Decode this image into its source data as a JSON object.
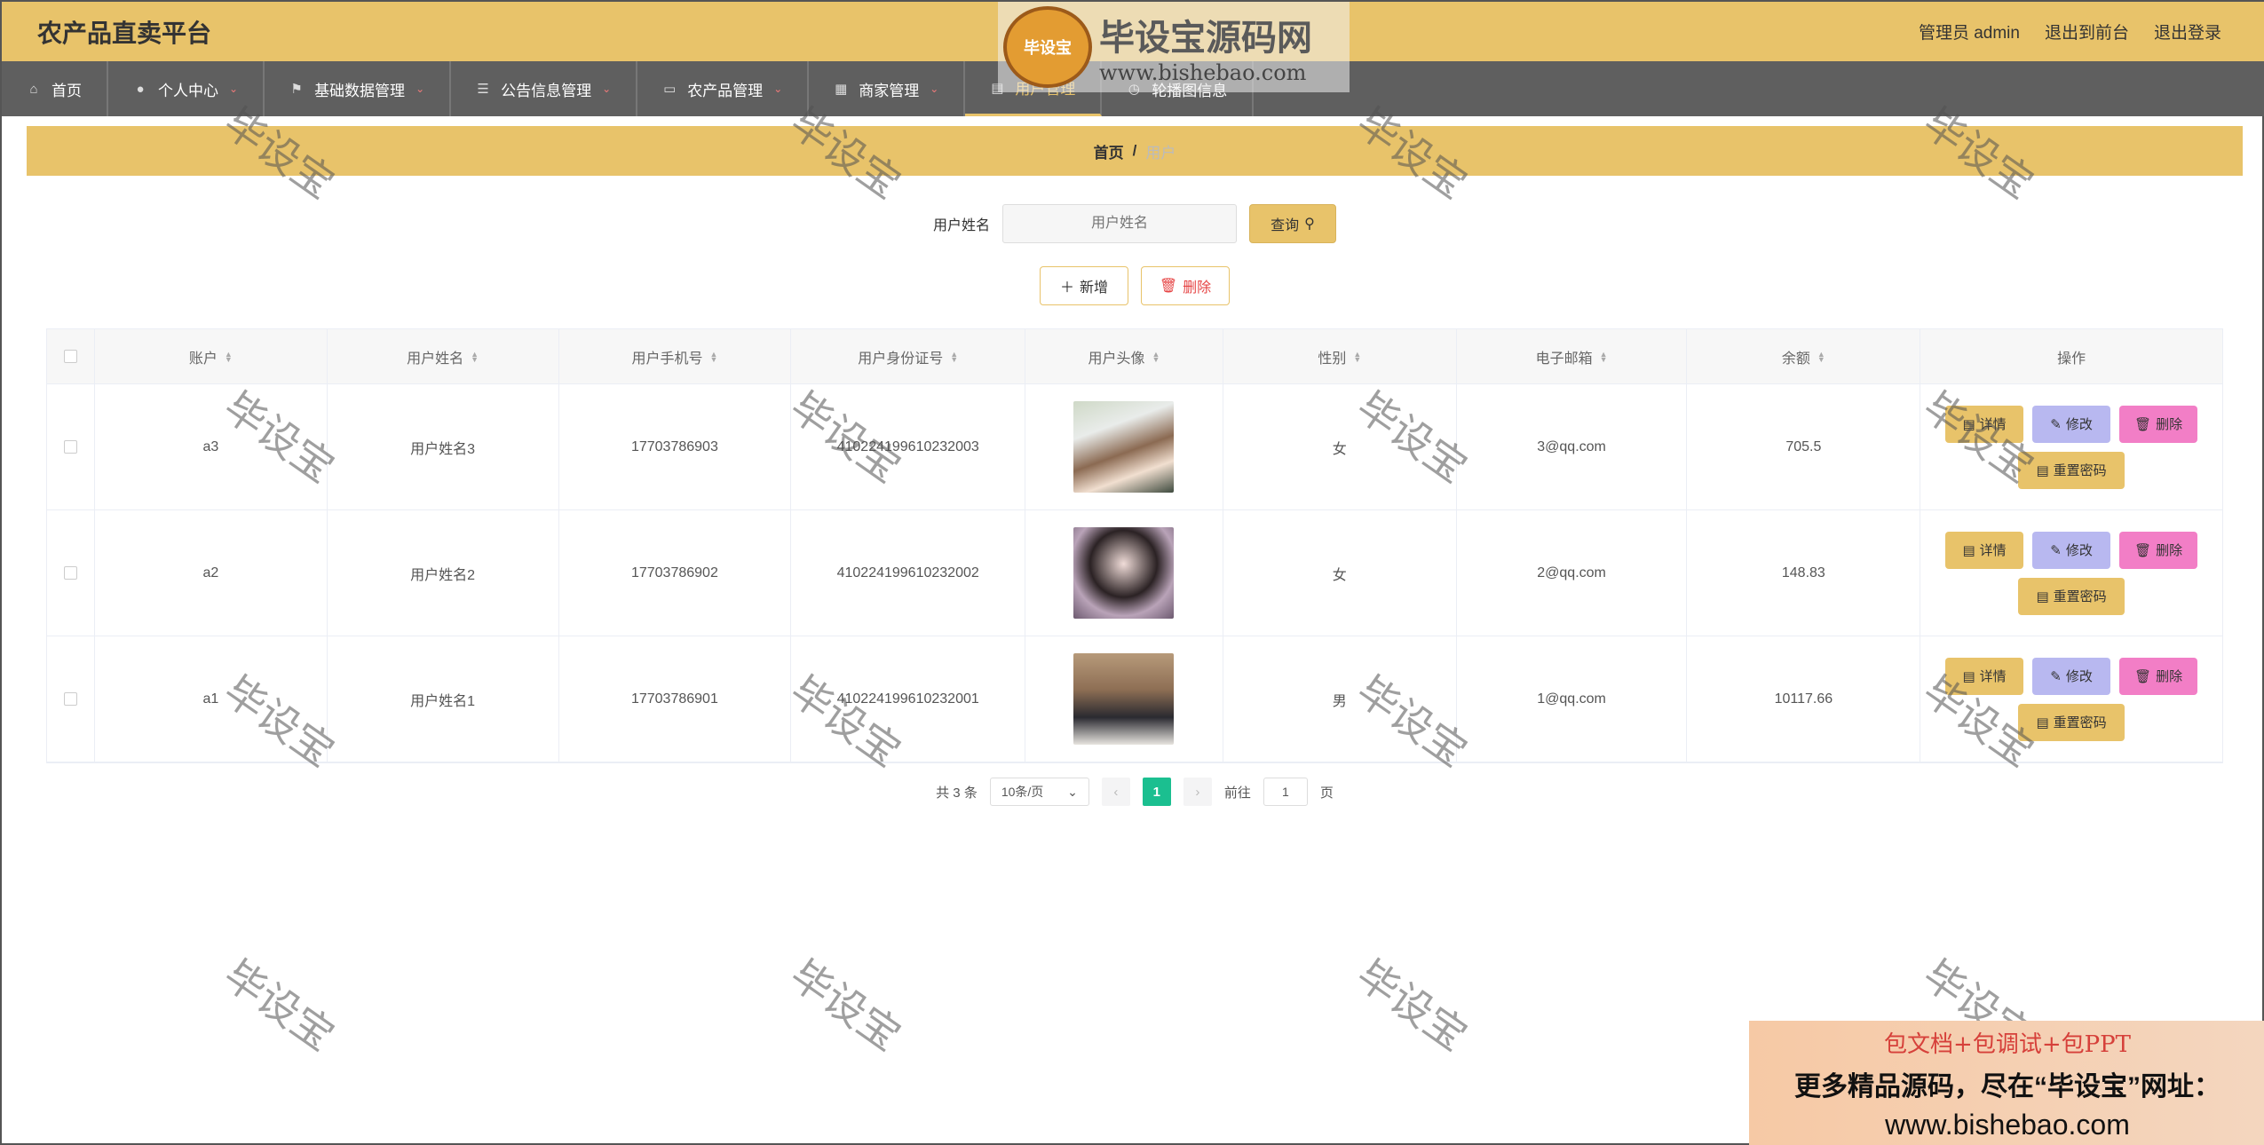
{
  "header": {
    "title": "农产品直卖平台",
    "admin_label": "管理员 admin",
    "to_front": "退出到前台",
    "logout": "退出登录"
  },
  "nav": [
    {
      "label": "首页",
      "icon": "home-icon",
      "has_caret": false,
      "active": false
    },
    {
      "label": "个人中心",
      "icon": "user-icon",
      "has_caret": true,
      "active": false
    },
    {
      "label": "基础数据管理",
      "icon": "flag-icon",
      "has_caret": true,
      "active": false
    },
    {
      "label": "公告信息管理",
      "icon": "sliders-icon",
      "has_caret": true,
      "active": false
    },
    {
      "label": "农产品管理",
      "icon": "chat-icon",
      "has_caret": true,
      "active": false
    },
    {
      "label": "商家管理",
      "icon": "grid-icon",
      "has_caret": true,
      "active": false
    },
    {
      "label": "用户管理",
      "icon": "clipboard-icon",
      "has_caret": false,
      "active": true
    },
    {
      "label": "轮播图信息",
      "icon": "clock-icon",
      "has_caret": false,
      "active": false
    }
  ],
  "breadcrumb": {
    "home": "首页",
    "separator": "/",
    "current": "用户"
  },
  "search": {
    "label": "用户姓名",
    "placeholder": "用户姓名",
    "query_button": "查询"
  },
  "actions": {
    "add": "新增",
    "delete": "删除"
  },
  "table": {
    "columns": [
      "账户",
      "用户姓名",
      "用户手机号",
      "用户身份证号",
      "用户头像",
      "性别",
      "电子邮箱",
      "余额",
      "操作"
    ],
    "rows": [
      {
        "account": "a3",
        "name": "用户姓名3",
        "phone": "17703786903",
        "id_card": "410224199610232003",
        "gender": "女",
        "email": "3@qq.com",
        "balance": "705.5"
      },
      {
        "account": "a2",
        "name": "用户姓名2",
        "phone": "17703786902",
        "id_card": "410224199610232002",
        "gender": "女",
        "email": "2@qq.com",
        "balance": "148.83"
      },
      {
        "account": "a1",
        "name": "用户姓名1",
        "phone": "17703786901",
        "id_card": "410224199610232001",
        "gender": "男",
        "email": "1@qq.com",
        "balance": "10117.66"
      }
    ],
    "row_actions": {
      "detail": "详情",
      "edit": "修改",
      "delete": "删除",
      "reset": "重置密码"
    }
  },
  "pagination": {
    "total": "共 3 条",
    "page_size": "10条/页",
    "current": "1",
    "goto_prefix": "前往",
    "goto_value": "1",
    "goto_suffix": "页"
  },
  "watermark": {
    "badge": "毕设宝",
    "name": "毕设宝源码网",
    "url": "www.bishebao.com",
    "stamp": "毕设宝"
  },
  "ad": {
    "line1": "包文档+包调试+包PPT",
    "line2": "更多精品源码，尽在“毕设宝”网址：",
    "line3": "www.bishebao.com"
  },
  "colors": {
    "accent": "#e8c36a",
    "nav_bg": "#5f5f5f",
    "page_active": "#1bbf90",
    "edit": "#b8b8f0",
    "danger": "#f27ec6"
  }
}
